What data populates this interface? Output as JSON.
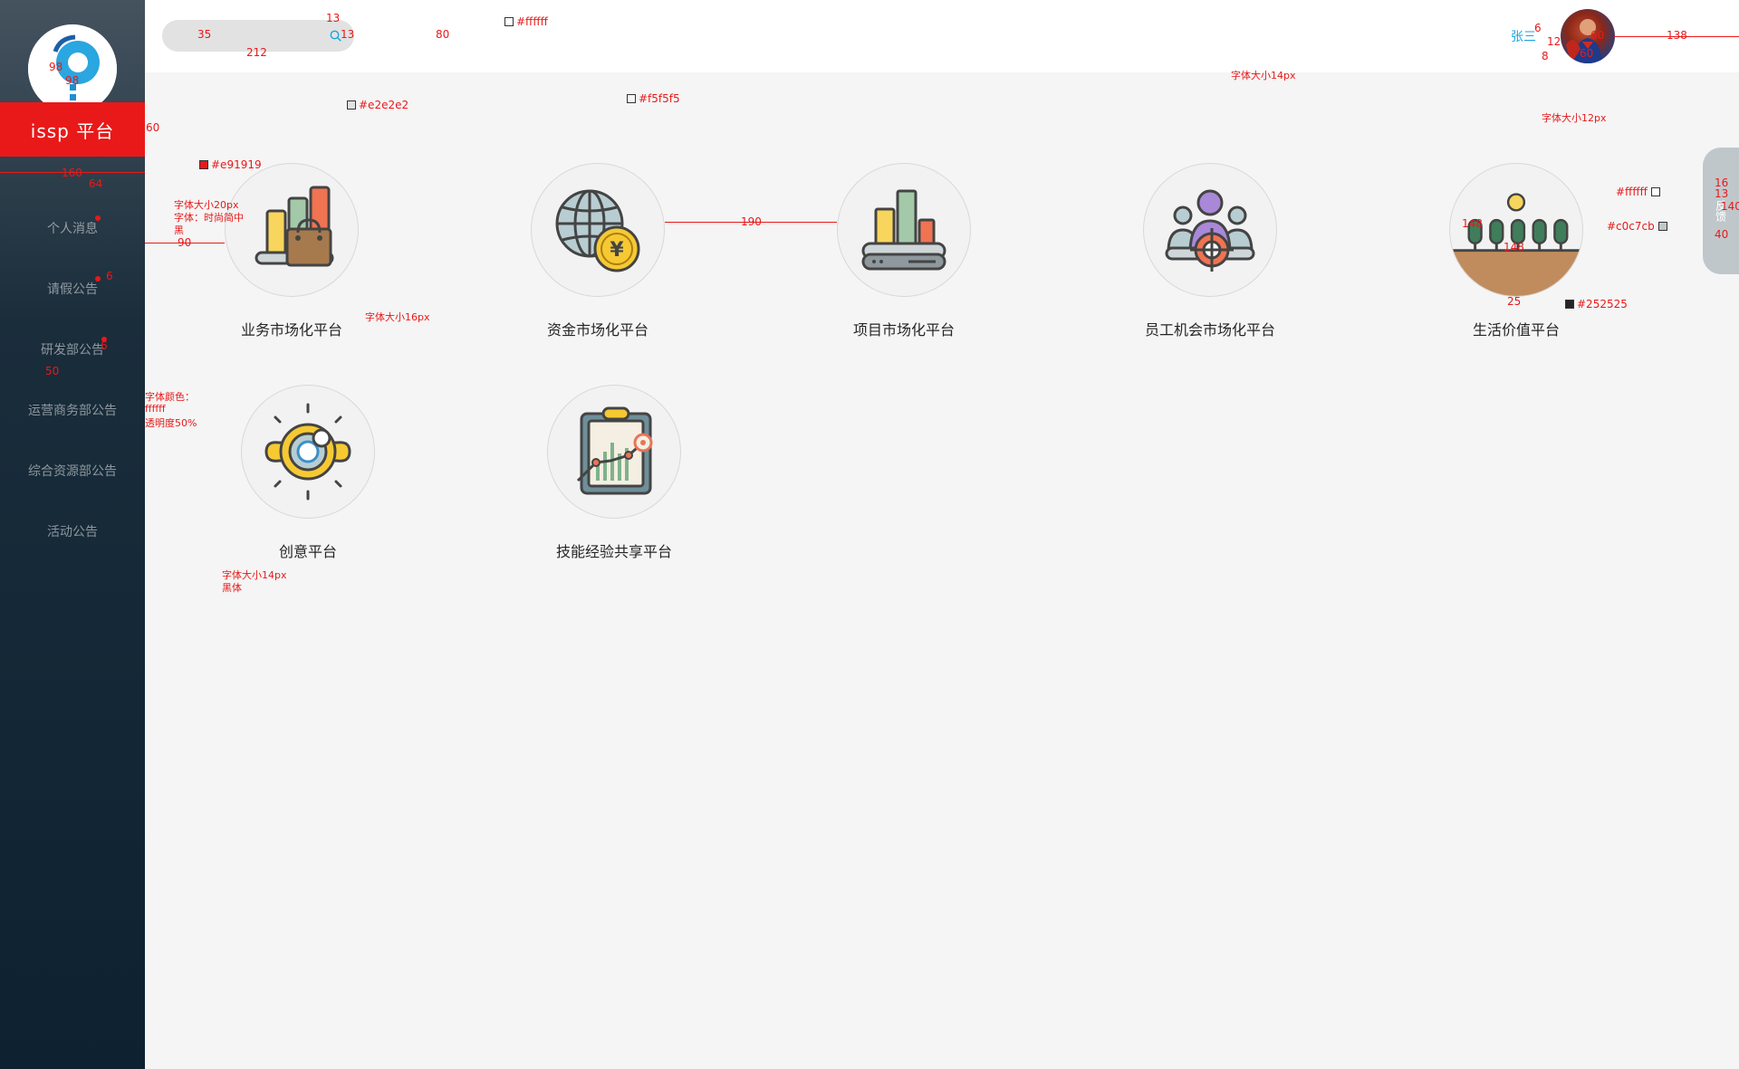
{
  "sidebar": {
    "brand": "issp 平台",
    "items": [
      {
        "label": "个人消息"
      },
      {
        "label": "请假公告"
      },
      {
        "label": "研发部公告"
      },
      {
        "label": "运营商务部公告"
      },
      {
        "label": "综合资源部公告"
      },
      {
        "label": "活动公告"
      }
    ]
  },
  "header": {
    "user_name": "张三"
  },
  "platforms": [
    {
      "label": "业务市场化平台",
      "icon": "shopping-bag-chart-icon"
    },
    {
      "label": "资金市场化平台",
      "icon": "globe-yen-icon"
    },
    {
      "label": "项目市场化平台",
      "icon": "server-bar-chart-icon"
    },
    {
      "label": "员工机会市场化平台",
      "icon": "team-target-icon"
    },
    {
      "label": "生活价值平台",
      "icon": "trees-sun-icon"
    },
    {
      "label": "创意平台",
      "icon": "creative-lens-icon"
    },
    {
      "label": "技能经验共享平台",
      "icon": "clipboard-chart-icon"
    }
  ],
  "side_tab": {
    "label": "反馈"
  },
  "annotations": {
    "logo_w": "98",
    "logo_h": "98",
    "brand_h": "60",
    "sidebar_w": "160",
    "brand_text_w": "64",
    "brand_font": "字体大小20px",
    "brand_font2": "字体：时尚简中",
    "brand_font3": "黑",
    "brand_color": "#e91919",
    "nav_gap": "50",
    "nav_dot": "6",
    "nav_dot2": "6",
    "nav_color1": "字体颜色：",
    "nav_color2": "ffffff",
    "nav_color3": "透明度50%",
    "nav_font1": "字体大小14px",
    "nav_font2": "黑体",
    "search_h": "35",
    "search_w": "212",
    "search_icon_w": "13",
    "search_icon_h": "13",
    "search_color": "#e2e2e2",
    "top_h": "80",
    "top_color": "#ffffff",
    "bg_color": "#f5f5f5",
    "left_gap": "90",
    "card_gap": "190",
    "label_font": "字体大小16px",
    "circle_h": "148",
    "circle_w": "148",
    "label_gap": "25",
    "label_color": "#252525",
    "user_font": "字体大小14px",
    "avatar_w": "60",
    "avatar_h": "60",
    "avatar_right": "138",
    "name_gap1": "6",
    "name_gap2": "12",
    "name_gap3": "8",
    "tab_font": "字体大小12px",
    "tab_text_color": "#ffffff",
    "tab_color": "#c0c7cb",
    "tab_16": "16",
    "tab_13": "13",
    "tab_140": "140",
    "tab_40": "40"
  }
}
